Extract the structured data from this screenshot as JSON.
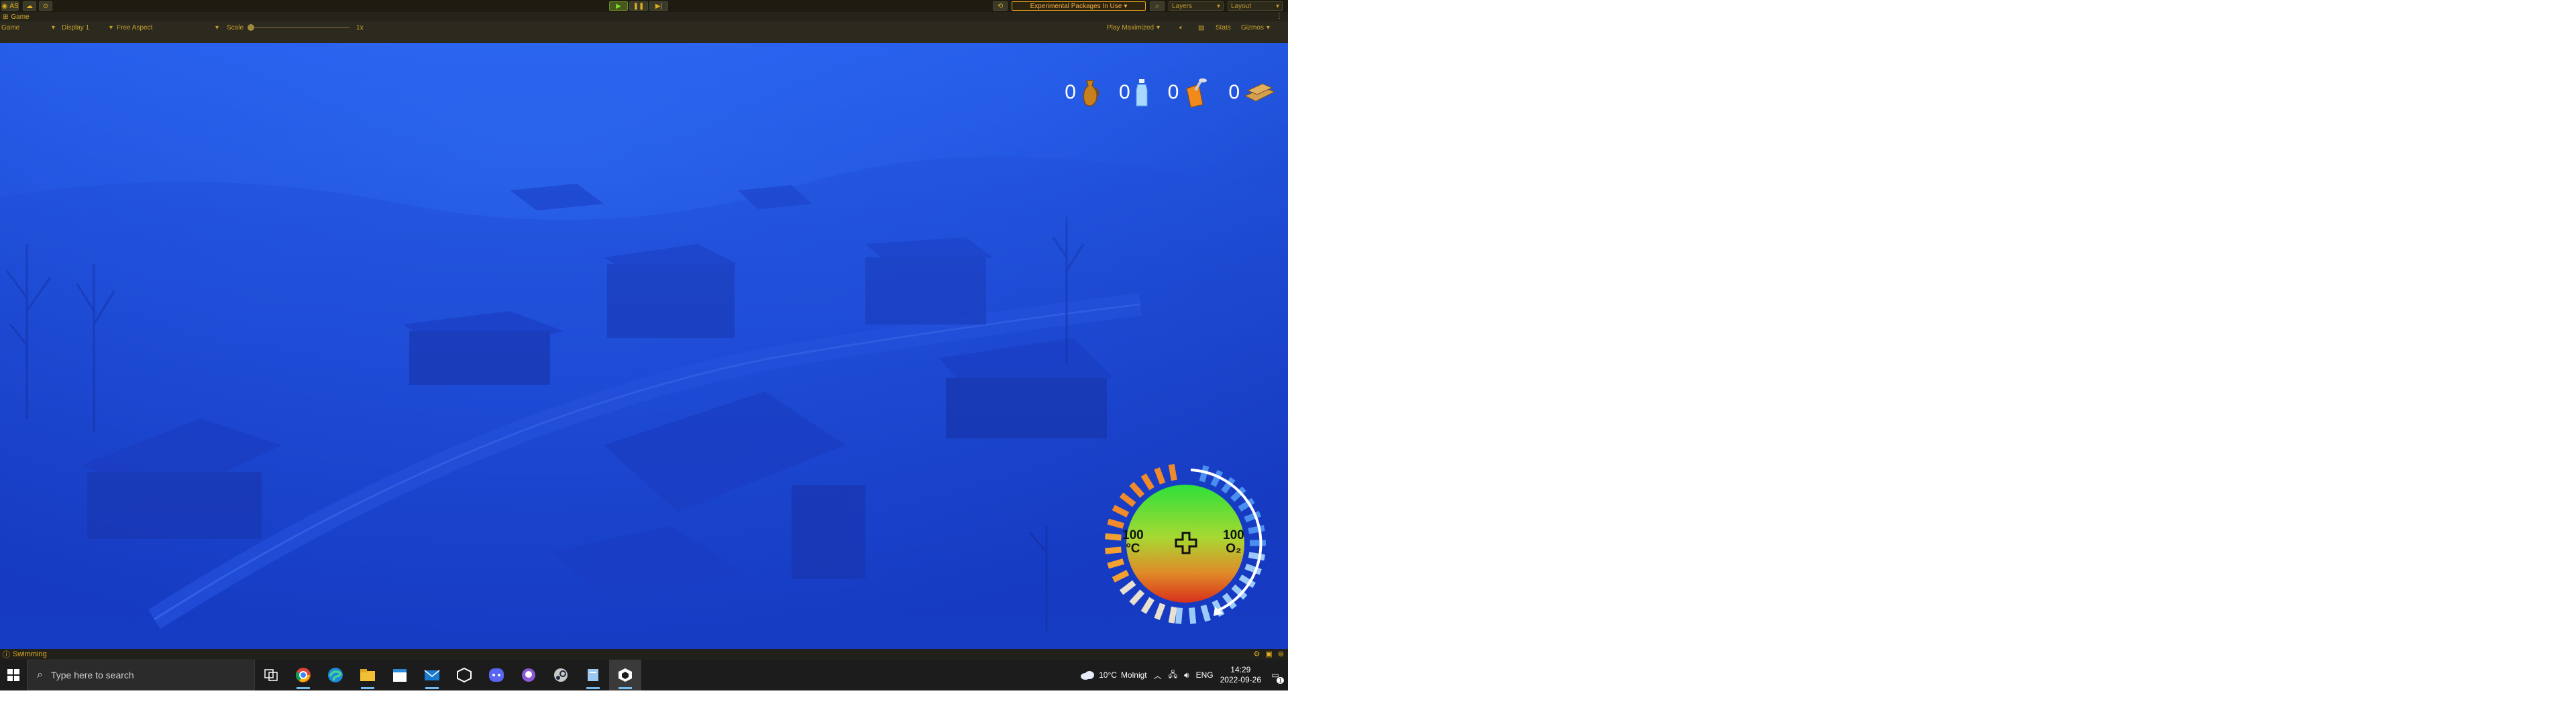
{
  "toolbar": {
    "account_label": "AS",
    "packages_label": "Experimental Packages In Use",
    "layers_label": "Layers",
    "layout_label": "Layout"
  },
  "game_tab": {
    "label": "Game"
  },
  "game_bar": {
    "view_label": "Game",
    "display_label": "Display 1",
    "aspect_label": "Free Aspect",
    "scale_label": "Scale",
    "scale_value": "1x",
    "play_mode_label": "Play Maximized",
    "stats_label": "Stats",
    "gizmos_label": "Gizmos"
  },
  "hud": {
    "counters": [
      {
        "icon": "jug-icon",
        "count": "0"
      },
      {
        "icon": "water-bottle-icon",
        "count": "0"
      },
      {
        "icon": "canned-food-icon",
        "count": "0"
      },
      {
        "icon": "wood-planks-icon",
        "count": "0"
      }
    ],
    "gauge": {
      "temperature_value": "100",
      "temperature_unit": "°C",
      "oxygen_value": "100",
      "oxygen_unit": "O₂",
      "health_icon": "cross-icon"
    }
  },
  "status_bar": {
    "text": "Swimming"
  },
  "taskbar": {
    "search_placeholder": "Type here to search",
    "apps": [
      "task-view-icon",
      "chrome-icon",
      "edge-icon",
      "file-explorer-icon",
      "calendar-icon",
      "mail-icon",
      "unity-hub-icon",
      "discord-icon",
      "github-desktop-icon",
      "steam-icon",
      "files-icon",
      "unity-icon"
    ],
    "weather_temp": "10°C",
    "weather_desc": "Molnigt",
    "language": "ENG",
    "time": "14:29",
    "date": "2022-09-26",
    "notification_count": "1"
  },
  "colors": {
    "toolbar_bg": "#1e1c11",
    "accent_yellow": "#e0b020",
    "scene_blue": "#1f4fe0",
    "gauge_orange": "#f08a2a",
    "gauge_blue": "#5aa0f0"
  }
}
